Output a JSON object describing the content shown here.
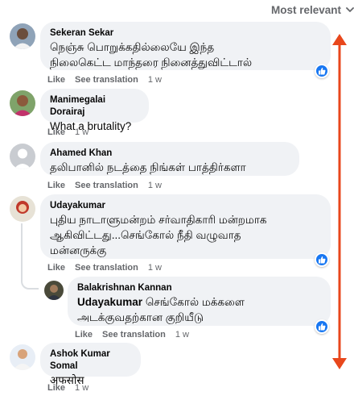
{
  "sort": {
    "label": "Most relevant"
  },
  "comments": [
    {
      "author": "Sekeran Sekar",
      "text_lines": [
        "நெஞ்சு பொறுக்கதில்லையே இந்த",
        "நிலைகெட்ட மாந்தரை நினைத்துவிட்டால்"
      ],
      "like": "Like",
      "translate": "See translation",
      "time": "1 w"
    },
    {
      "author": "Manimegalai Dorairaj",
      "text_lines": [
        "What a brutality?"
      ],
      "like": "Like",
      "time": "1 w"
    },
    {
      "author": "Ahamed Khan",
      "text_lines": [
        "தலிபானில் நடத்தை நிங்கள் பாத்திர்களா"
      ],
      "like": "Like",
      "translate": "See translation",
      "time": "1 w"
    },
    {
      "author": "Udayakumar",
      "text_lines": [
        "புதிய நாடாளுமன்றம் சர்வாதிகாரி மன்றமாக",
        "ஆகிவிட்டது...செங்கோல் நீதி வழுவாத",
        "மன்னருக்கு"
      ],
      "like": "Like",
      "translate": "See translation",
      "time": "1 w"
    },
    {
      "author": "Balakrishnan Kannan",
      "mention": "Udayakumar",
      "text_lines": [
        "செங்கோல் மக்களை",
        "அடக்குவதற்கான குறியீடு"
      ],
      "like": "Like",
      "translate": "See translation",
      "time": "1 w"
    },
    {
      "author": "Ashok Kumar Somal",
      "text_lines": [
        "अफसोस"
      ],
      "like": "Like",
      "time": "1 w"
    }
  ],
  "icons": {
    "sort": "chevron-down-icon",
    "like_reaction": "thumbs-up-icon",
    "annotation": "double-headed-arrow-icon"
  },
  "colors": {
    "bubble": "#f0f2f5",
    "meta_text": "#65676b",
    "like_blue": "#1877f2",
    "annotation_arrow": "#e8471c"
  }
}
